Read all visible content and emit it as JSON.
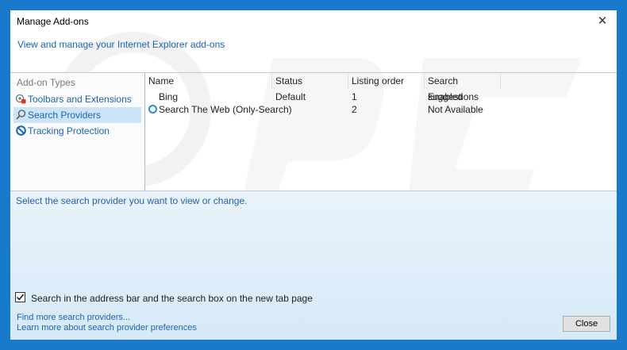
{
  "window": {
    "title": "Manage Add-ons",
    "close_glyph": "✕"
  },
  "header": {
    "link": "View and manage your Internet Explorer add-ons"
  },
  "sidebar": {
    "heading": "Add-on Types",
    "items": [
      {
        "label": "Toolbars and Extensions",
        "icon": "toolbars-extensions-icon",
        "selected": false
      },
      {
        "label": "Search Providers",
        "icon": "search-icon",
        "selected": true
      },
      {
        "label": "Tracking Protection",
        "icon": "tracking-protection-icon",
        "selected": false
      }
    ]
  },
  "list": {
    "columns": [
      "Name",
      "Status",
      "Listing order",
      "Search suggestions"
    ],
    "rows": [
      {
        "name": "Bing",
        "status": "Default",
        "order": "1",
        "suggestions": "Enabled",
        "icon": ""
      },
      {
        "name": "Search The Web (Only-Search)",
        "status": "",
        "order": "2",
        "suggestions": "Not Available",
        "icon": "search-provider-icon"
      }
    ]
  },
  "details": {
    "hint": "Select the search provider you want to view or change.",
    "checkbox_label": "Search in the address bar and the search box on the new tab page",
    "checkbox_checked": true
  },
  "footer": {
    "link1": "Find more search providers...",
    "link2": "Learn more about search provider preferences",
    "close_label": "Close"
  },
  "colors": {
    "accent": "#1a64b4",
    "frame": "#1979ca",
    "selected_bg": "#cce4f7"
  }
}
